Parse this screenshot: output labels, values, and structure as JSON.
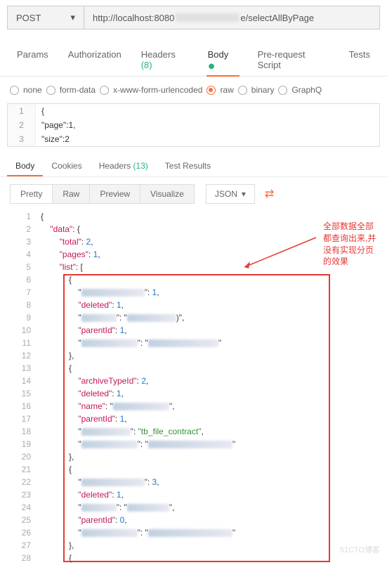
{
  "request": {
    "method": "POST",
    "url_prefix": "http://localhost:8080",
    "url_suffix": "e/selectAllByPage"
  },
  "tabs": {
    "params": "Params",
    "authorization": "Authorization",
    "headers": "Headers",
    "headers_count": "(8)",
    "body": "Body",
    "prerequest": "Pre-request Script",
    "tests": "Tests"
  },
  "body_types": {
    "none": "none",
    "formdata": "form-data",
    "urlencoded": "x-www-form-urlencoded",
    "raw": "raw",
    "binary": "binary",
    "graphql": "GraphQ"
  },
  "request_body": {
    "line1": "{",
    "line2": "\"page\":1,",
    "line3": "\"size\":2"
  },
  "response_tabs": {
    "body": "Body",
    "cookies": "Cookies",
    "headers": "Headers",
    "headers_count": "(13)",
    "testresults": "Test Results"
  },
  "view": {
    "pretty": "Pretty",
    "raw": "Raw",
    "preview": "Preview",
    "visualize": "Visualize",
    "format": "JSON"
  },
  "response": {
    "lines": [
      {
        "n": 1,
        "text": "{"
      },
      {
        "n": 2,
        "indent": 1,
        "key": "\"data\"",
        "after": ": {"
      },
      {
        "n": 3,
        "indent": 2,
        "key": "\"total\"",
        "after": ": ",
        "val": "2",
        "vclass": "num",
        "comma": ","
      },
      {
        "n": 4,
        "indent": 2,
        "key": "\"pages\"",
        "after": ": ",
        "val": "1",
        "vclass": "num",
        "comma": ","
      },
      {
        "n": 5,
        "indent": 2,
        "key": "\"list\"",
        "after": ": ["
      },
      {
        "n": 6,
        "indent": 3,
        "text": "{"
      },
      {
        "n": 7,
        "indent": 4,
        "blur_key": 90,
        "after": "\": ",
        "val": "1",
        "vclass": "num",
        "comma": ","
      },
      {
        "n": 8,
        "indent": 4,
        "key": "\"deleted\"",
        "after": ": ",
        "val": "1",
        "vclass": "num",
        "comma": ","
      },
      {
        "n": 9,
        "indent": 4,
        "blur_key": 50,
        "blur_val": 70,
        "after": "\": \"",
        "close": ")\"",
        "comma": ","
      },
      {
        "n": 10,
        "indent": 4,
        "key": "\"parentId\"",
        "after": ": ",
        "val": "1",
        "vclass": "num",
        "comma": ","
      },
      {
        "n": 11,
        "indent": 4,
        "blur_key": 80,
        "blur_val": 100,
        "after": "\": \"",
        "close": "\""
      },
      {
        "n": 12,
        "indent": 3,
        "text": "},"
      },
      {
        "n": 13,
        "indent": 3,
        "text": "{"
      },
      {
        "n": 14,
        "indent": 4,
        "key": "\"archiveTypeId\"",
        "after": ": ",
        "val": "2",
        "vclass": "num",
        "comma": ","
      },
      {
        "n": 15,
        "indent": 4,
        "key": "\"deleted\"",
        "after": ": ",
        "val": "1",
        "vclass": "num",
        "comma": ","
      },
      {
        "n": 16,
        "indent": 4,
        "key": "\"name\"",
        "after": ": \"",
        "blur_val": 80,
        "close": "\"",
        "comma": ","
      },
      {
        "n": 17,
        "indent": 4,
        "key": "\"parentId\"",
        "after": ": ",
        "val": "1",
        "vclass": "num",
        "comma": ","
      },
      {
        "n": 18,
        "indent": 4,
        "blur_key": 70,
        "after": "\": ",
        "val": "\"tb_file_contract\"",
        "vclass": "str",
        "comma": ","
      },
      {
        "n": 19,
        "indent": 4,
        "blur_key": 80,
        "blur_val": 120,
        "after": "\": \"",
        "close": "\""
      },
      {
        "n": 20,
        "indent": 3,
        "text": "},"
      },
      {
        "n": 21,
        "indent": 3,
        "text": "{"
      },
      {
        "n": 22,
        "indent": 4,
        "blur_key": 90,
        "after": "\": ",
        "val": "3",
        "vclass": "num",
        "comma": ","
      },
      {
        "n": 23,
        "indent": 4,
        "key": "\"deleted\"",
        "after": ": ",
        "val": "1",
        "vclass": "num",
        "comma": ","
      },
      {
        "n": 24,
        "indent": 4,
        "blur_key": 50,
        "blur_val": 60,
        "after": "\": \"",
        "close": "\"",
        "comma": ","
      },
      {
        "n": 25,
        "indent": 4,
        "key": "\"parentId\"",
        "after": ": ",
        "val": "0",
        "vclass": "num",
        "comma": ","
      },
      {
        "n": 26,
        "indent": 4,
        "blur_key": 80,
        "blur_val": 120,
        "after": "\": \"",
        "close": "\""
      },
      {
        "n": 27,
        "indent": 3,
        "text": "},"
      },
      {
        "n": 28,
        "indent": 3,
        "text": "{"
      }
    ]
  },
  "annotation": "全部数据全部\n都查询出来,并\n没有实现分页\n的效果",
  "watermark": "51CTO博客"
}
